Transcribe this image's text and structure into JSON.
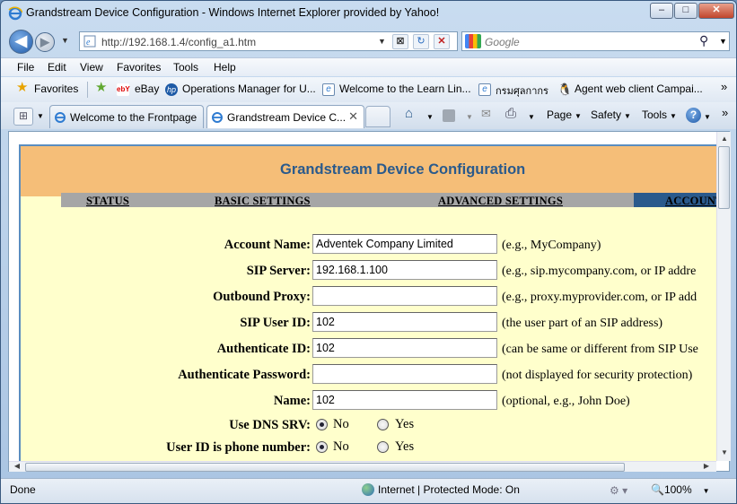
{
  "window": {
    "title": "Grandstream Device Configuration - Windows Internet Explorer provided by Yahoo!",
    "minimize": "–",
    "maximize": "□",
    "close": "✕"
  },
  "address": {
    "url": "http://192.168.1.4/config_a1.htm"
  },
  "search": {
    "placeholder": "Google"
  },
  "menu": [
    "File",
    "Edit",
    "View",
    "Favorites",
    "Tools",
    "Help"
  ],
  "favorites": {
    "label": "Favorites",
    "links": [
      "eBay",
      "Operations Manager for U...",
      "Welcome to the Learn Lin...",
      "กรมศุลกากร",
      "Agent web client Campai..."
    ],
    "more": "»"
  },
  "tabs": [
    {
      "label": "Welcome to the Frontpage",
      "active": false
    },
    {
      "label": "Grandstream Device C...",
      "active": true
    }
  ],
  "commands": {
    "page": "Page",
    "safety": "Safety",
    "tools": "Tools",
    "help": "?",
    "more": "»"
  },
  "page": {
    "heading": "Grandstream Device Configuration",
    "nav": [
      "STATUS",
      "BASIC SETTINGS",
      "ADVANCED SETTINGS",
      "ACCOUNT"
    ],
    "fields": [
      {
        "label": "Account Name:",
        "value": "Adventek Company Limited",
        "hint": "(e.g., MyCompany)"
      },
      {
        "label": "SIP Server:",
        "value": "192.168.1.100",
        "hint": "(e.g., sip.mycompany.com, or IP addre"
      },
      {
        "label": "Outbound Proxy:",
        "value": "",
        "hint": "(e.g., proxy.myprovider.com, or IP add"
      },
      {
        "label": "SIP User ID:",
        "value": "102",
        "hint": "(the user part of an SIP address)"
      },
      {
        "label": "Authenticate ID:",
        "value": "102",
        "hint": "(can be same or different from SIP Use"
      },
      {
        "label": "Authenticate Password:",
        "value": "",
        "hint": "(not displayed for security protection)"
      },
      {
        "label": "Name:",
        "value": "102",
        "hint": "(optional, e.g., John Doe)"
      }
    ],
    "radios": [
      {
        "label": "Use DNS SRV:",
        "options": [
          "No",
          "Yes"
        ],
        "selected": "No"
      },
      {
        "label": "User ID is phone number:",
        "options": [
          "No",
          "Yes"
        ],
        "selected": "No"
      }
    ]
  },
  "status": {
    "text": "Done",
    "zone": "Internet | Protected Mode: On",
    "zoom": "100%"
  }
}
